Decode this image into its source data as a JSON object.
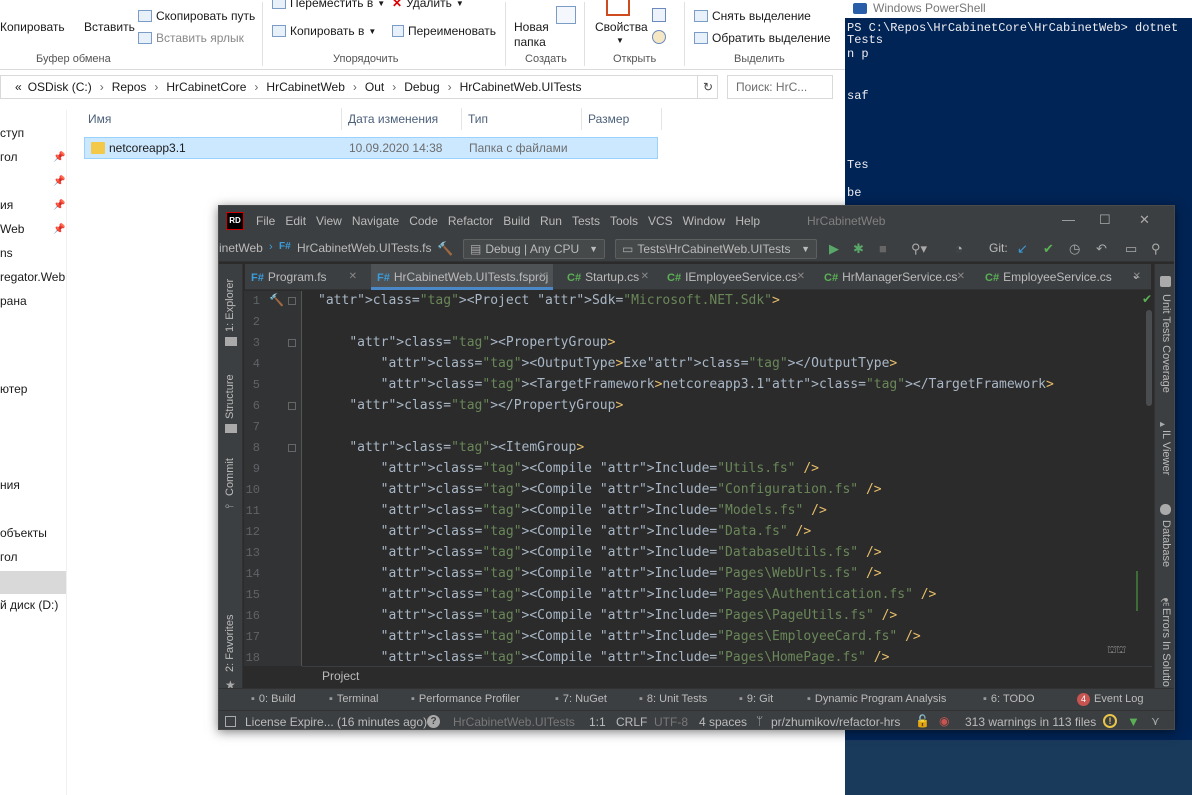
{
  "explorer": {
    "ribbon": {
      "copy": "Копировать",
      "paste": "Вставить",
      "copy_path": "Скопировать путь",
      "paste_shortcut": "Вставить ярлык",
      "move_to": "Переместить в",
      "copy_to": "Копировать в",
      "delete": "Удалить",
      "rename": "Переименовать",
      "new_folder_1": "Новая",
      "new_folder_2": "папка",
      "properties": "Свойства",
      "deselect": "Снять выделение",
      "invert_selection": "Обратить выделение",
      "groups": {
        "clipboard": "Буфер обмена",
        "organize": "Упорядочить",
        "new": "Создать",
        "open": "Открыть",
        "select": "Выделить"
      }
    },
    "address": {
      "prefix": "«",
      "segments": [
        "OSDisk (C:)",
        "Repos",
        "HrCabinetCore",
        "HrCabinetWeb",
        "Out",
        "Debug",
        "HrCabinetWeb.UITests"
      ]
    },
    "search_placeholder": "Поиск: HrC...",
    "nav_items": [
      "ступ",
      "гол",
      "",
      "ия",
      "Web",
      "ns",
      "regator.Web",
      "рана",
      "",
      "ютер",
      "",
      "ния",
      "",
      "объекты",
      "гол",
      "",
      "й диск (D:)"
    ],
    "columns": [
      "Имя",
      "Дата изменения",
      "Тип",
      "Размер"
    ],
    "rows": [
      {
        "name": "netcoreapp3.1",
        "date": "10.09.2020 14:38",
        "type": "Папка с файлами",
        "size": ""
      }
    ]
  },
  "powershell": {
    "title": "Windows PowerShell",
    "lines": [
      {
        "text": "Tests",
        "row": 0
      },
      {
        "text": "PS C:\\Repos\\HrCabinetCore\\HrCabinetWeb> dotnet",
        "row": 1
      },
      {
        "text": "n p",
        "row": 2
      },
      {
        "text": "saf",
        "row": 6
      },
      {
        "text": "Tes",
        "row": 10
      },
      {
        "text": " be",
        "row": 12
      }
    ]
  },
  "rider": {
    "logo": "RD",
    "menu": [
      "File",
      "Edit",
      "View",
      "Navigate",
      "Code",
      "Refactor",
      "Build",
      "Run",
      "Tests",
      "Tools",
      "VCS",
      "Window",
      "Help"
    ],
    "window_title": "HrCabinetWeb",
    "toolbar": {
      "crumb_solution": "inetWeb",
      "crumb_file": "HrCabinetWeb.UITests.fs",
      "config": "Debug | Any CPU",
      "run_config": "Tests\\HrCabinetWeb.UITests",
      "git_label": "Git:"
    },
    "tabs": [
      {
        "lang": "F#",
        "label": "Program.fs",
        "kind": "fs"
      },
      {
        "lang": "F#",
        "label": "HrCabinetWeb.UITests.fsproj",
        "kind": "fs"
      },
      {
        "lang": "C#",
        "label": "Startup.cs",
        "kind": "cs"
      },
      {
        "lang": "C#",
        "label": "IEmployeeService.cs",
        "kind": "cs"
      },
      {
        "lang": "C#",
        "label": "HrManagerService.cs",
        "kind": "cs"
      },
      {
        "lang": "C#",
        "label": "EmployeeService.cs",
        "kind": "cs"
      }
    ],
    "left_tools": [
      "1: Explorer",
      "Structure",
      "Commit",
      "2: Favorites"
    ],
    "right_tools": [
      "Unit Tests Coverage",
      "IL Viewer",
      "Database",
      "Errors In Solutio"
    ],
    "code_lines": [
      "<Project Sdk=\"Microsoft.NET.Sdk\">",
      "",
      "    <PropertyGroup>",
      "        <OutputType>Exe</OutputType>",
      "        <TargetFramework>netcoreapp3.1</TargetFramework>",
      "    </PropertyGroup>",
      "",
      "    <ItemGroup>",
      "        <Compile Include=\"Utils.fs\" />",
      "        <Compile Include=\"Configuration.fs\" />",
      "        <Compile Include=\"Models.fs\" />",
      "        <Compile Include=\"Data.fs\" />",
      "        <Compile Include=\"DatabaseUtils.fs\" />",
      "        <Compile Include=\"Pages\\WebUrls.fs\" />",
      "        <Compile Include=\"Pages\\Authentication.fs\" />",
      "        <Compile Include=\"Pages\\PageUtils.fs\" />",
      "        <Compile Include=\"Pages\\EmployeeCard.fs\" />",
      "        <Compile Include=\"Pages\\HomePage.fs\" />"
    ],
    "breadcrumb": "Project",
    "tool_windows": [
      "0: Build",
      "Terminal",
      "Performance Profiler",
      "7: NuGet",
      "8: Unit Tests",
      "9: Git",
      "Dynamic Program Analysis",
      "6: TODO",
      "Event Log"
    ],
    "event_count": "4",
    "status": {
      "license": "License Expire... (16 minutes ago)",
      "project": "HrCabinetWeb.UITests",
      "position": "1:1",
      "line_sep": "CRLF",
      "encoding": "UTF-8",
      "indent": "4 spaces",
      "branch": "pr/zhumikov/refactor-hrs",
      "warnings": "313 warnings in 113 files"
    }
  }
}
